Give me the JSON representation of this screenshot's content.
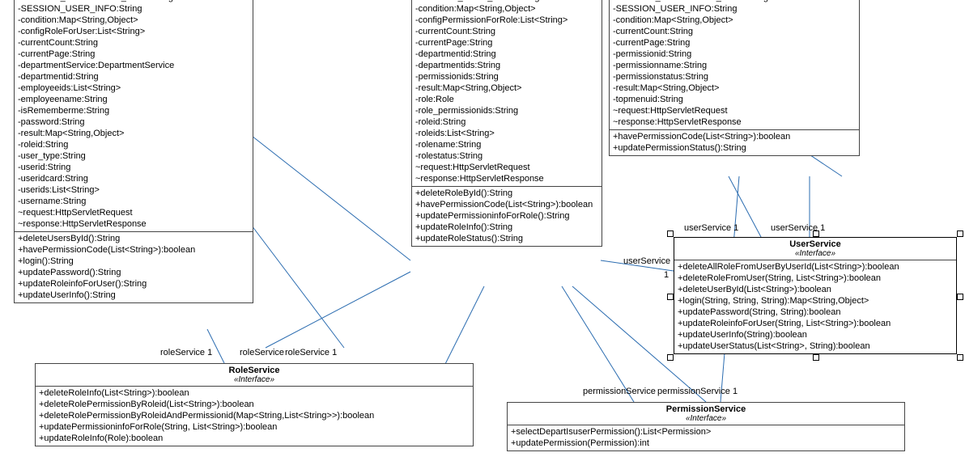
{
  "classA": {
    "attrs": [
      "-SESSION_PERMISSION_INFO:String",
      "-SESSION_USER_INFO:String",
      "-condition:Map<String,Object>",
      "-configRoleForUser:List<String>",
      "-currentCount:String",
      "-currentPage:String",
      "-departmentService:DepartmentService",
      "-departmentid:String",
      "-employeeids:List<String>",
      "-employeename:String",
      "-isRememberme:String",
      "-password:String",
      "-result:Map<String,Object>",
      "-roleid:String",
      "-user_type:String",
      "-userid:String",
      "-useridcard:String",
      "-userids:List<String>",
      "-username:String",
      "~request:HttpServletRequest",
      "~response:HttpServletResponse"
    ],
    "ops": [
      "+deleteUsersById():String",
      "+havePermissionCode(List<String>):boolean",
      "+login():String",
      "+updatePassword():String",
      "+updateRoleinfoForUser():String",
      "+updateUserInfo():String"
    ]
  },
  "classB": {
    "attrs": [
      "-SESSION_USER_INFO:String",
      "-condition:Map<String,Object>",
      "-configPermissionForRole:List<String>",
      "-currentCount:String",
      "-currentPage:String",
      "-departmentid:String",
      "-departmentids:String",
      "-permissionids:String",
      "-result:Map<String,Object>",
      "-role:Role",
      "-role_permissionids:String",
      "-roleid:String",
      "-roleids:List<String>",
      "-rolename:String",
      "-rolestatus:String",
      "~request:HttpServletRequest",
      "~response:HttpServletResponse"
    ],
    "ops": [
      "+deleteRoleById():String",
      "+havePermissionCode(List<String>):boolean",
      "+updatePermissioninfoForRole():String",
      "+updateRoleInfo():String",
      "+updateRoleStatus():String"
    ]
  },
  "classC": {
    "attrs": [
      "-SESSION_PERMISSION_INFO:String",
      "-SESSION_USER_INFO:String",
      "-condition:Map<String,Object>",
      "-currentCount:String",
      "-currentPage:String",
      "-permissionid:String",
      "-permissionname:String",
      "-permissionstatus:String",
      "-result:Map<String,Object>",
      "-topmenuid:String",
      "~request:HttpServletRequest",
      "~response:HttpServletResponse"
    ],
    "ops": [
      "+havePermissionCode(List<String>):boolean",
      "+updatePermissionStatus():String"
    ]
  },
  "roleService": {
    "title": "RoleService",
    "stereotype": "«Interface»",
    "ops": [
      "+deleteRoleInfo(List<String>):boolean",
      "+deleteRolePermissionByRoleid(List<String>):boolean",
      "+deleteRolePermissionByRoleidAndPermissionid(Map<String,List<String>>):boolean",
      "+updatePermissioninfoForRole(String, List<String>):boolean",
      "+updateRoleInfo(Role):boolean"
    ]
  },
  "userService": {
    "title": "UserService",
    "stereotype": "«Interface»",
    "ops": [
      "+deleteAllRoleFromUserByUserId(List<String>):boolean",
      "+deleteRoleFromUser(String, List<String>):boolean",
      "+deleteUserById(List<String>):boolean",
      "+login(String, String, String):Map<String,Object>",
      "+updatePassword(String, String):boolean",
      "+updateRoleinfoForUser(String, List<String>):boolean",
      "+updateUserInfo(String):boolean",
      "+updateUserStatus(List<String>, String):boolean"
    ]
  },
  "permissionService": {
    "title": "PermissionService",
    "stereotype": "«Interface»",
    "ops": [
      "+selectDepartIsuserPermission():List<Permission>",
      "+updatePermission(Permission):int"
    ]
  },
  "labels": {
    "roleService1": "roleService",
    "roleService2": "roleService",
    "roleService3": "roleService",
    "userService1": "userService",
    "userService2": "userService",
    "userService3": "userService",
    "permissionService1": "permissionService",
    "permissionService2": "permissionService",
    "one": "1"
  }
}
